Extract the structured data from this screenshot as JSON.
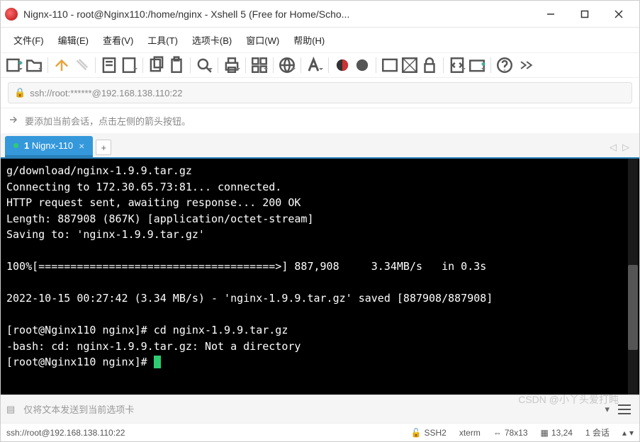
{
  "window": {
    "title": "Nignx-110 - root@Nginx110:/home/nginx - Xshell 5 (Free for Home/Scho..."
  },
  "menu": {
    "file": "文件(F)",
    "edit": "编辑(E)",
    "view": "查看(V)",
    "tools": "工具(T)",
    "tabs": "选项卡(B)",
    "window": "窗口(W)",
    "help": "帮助(H)"
  },
  "address": {
    "url": "ssh://root:******@192.168.138.110:22"
  },
  "hint": {
    "text": "要添加当前会话，点击左侧的箭头按钮。"
  },
  "tabs": {
    "active": {
      "index": "1",
      "label": "Nignx-110"
    }
  },
  "terminal": {
    "lines": [
      "g/download/nginx-1.9.9.tar.gz",
      "Connecting to 172.30.65.73:81... connected.",
      "HTTP request sent, awaiting response... 200 OK",
      "Length: 887908 (867K) [application/octet-stream]",
      "Saving to: 'nginx-1.9.9.tar.gz'",
      "",
      "100%[=====================================>] 887,908     3.34MB/s   in 0.3s",
      "",
      "2022-10-15 00:27:42 (3.34 MB/s) - 'nginx-1.9.9.tar.gz' saved [887908/887908]",
      "",
      "[root@Nginx110 nginx]# cd nginx-1.9.9.tar.gz",
      "-bash: cd: nginx-1.9.9.tar.gz: Not a directory"
    ],
    "prompt": "[root@Nginx110 nginx]# "
  },
  "inputbar": {
    "placeholder": "仅将文本发送到当前选项卡"
  },
  "status": {
    "conn": "ssh://root@192.168.138.110:22",
    "proto": "SSH2",
    "term": "xterm",
    "size": "78x13",
    "pos": "13,24",
    "sessions": "1 会话"
  },
  "watermark": "CSDN @小丫头爱打盹"
}
